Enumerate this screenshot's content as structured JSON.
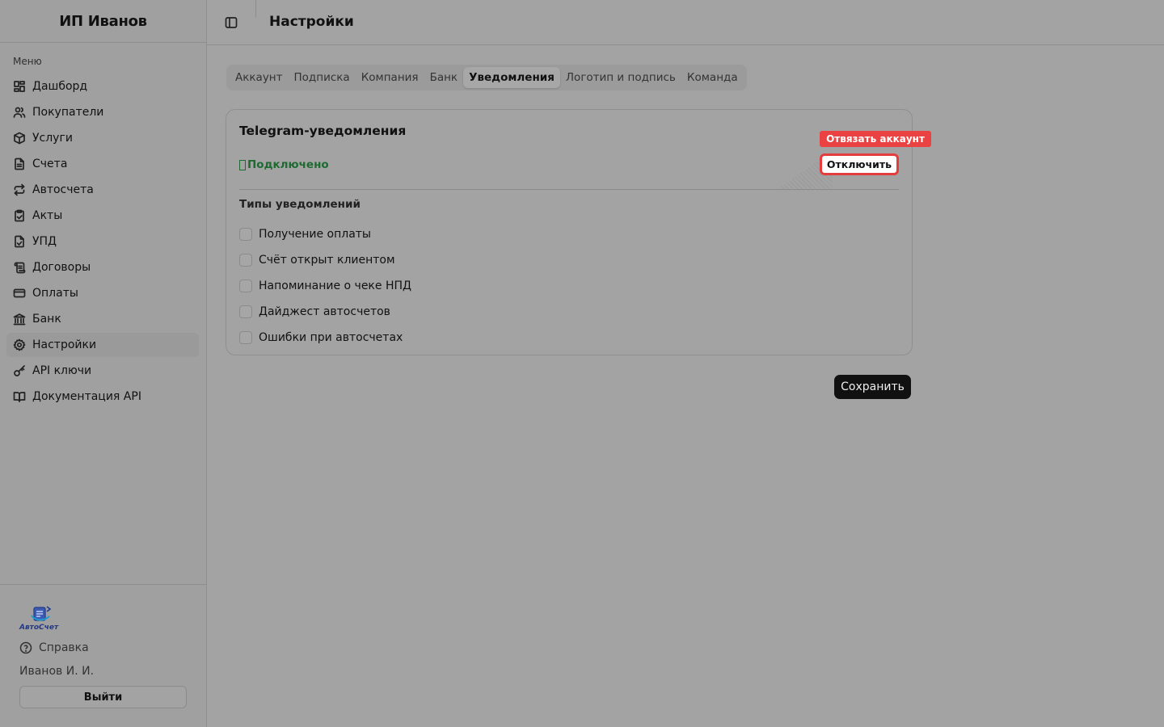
{
  "sidebar": {
    "org_name": "ИП Иванов",
    "menu_label": "Меню",
    "items": [
      {
        "label": "Дашборд",
        "icon": "dashboard-icon"
      },
      {
        "label": "Покупатели",
        "icon": "users-icon"
      },
      {
        "label": "Услуги",
        "icon": "package-icon"
      },
      {
        "label": "Счета",
        "icon": "file-text-icon"
      },
      {
        "label": "Автосчета",
        "icon": "repeat-icon"
      },
      {
        "label": "Акты",
        "icon": "clipboard-check-icon"
      },
      {
        "label": "УПД",
        "icon": "file-check-icon"
      },
      {
        "label": "Договоры",
        "icon": "scroll-icon"
      },
      {
        "label": "Оплаты",
        "icon": "credit-card-icon"
      },
      {
        "label": "Банк",
        "icon": "bank-icon"
      },
      {
        "label": "Настройки",
        "icon": "gear-icon",
        "active": true
      },
      {
        "label": "API ключи",
        "icon": "key-icon"
      },
      {
        "label": "Документация API",
        "icon": "book-icon"
      }
    ],
    "footer": {
      "logo_text": "АвтоСчет",
      "help_label": "Справка",
      "user_name": "Иванов И. И.",
      "logout_label": "Выйти"
    }
  },
  "header": {
    "title": "Настройки"
  },
  "tabs": [
    {
      "label": "Аккаунт"
    },
    {
      "label": "Подписка"
    },
    {
      "label": "Компания"
    },
    {
      "label": "Банк"
    },
    {
      "label": "Уведомления",
      "active": true
    },
    {
      "label": "Логотип и подпись"
    },
    {
      "label": "Команда"
    }
  ],
  "telegram": {
    "title": "Telegram-уведомления",
    "status": "Подключено",
    "disconnect_label": "Отключить",
    "tooltip": "Отвязать аккаунт",
    "types_label": "Типы уведомлений",
    "types": [
      {
        "label": "Получение оплаты",
        "checked": false
      },
      {
        "label": "Счёт открыт клиентом",
        "checked": false
      },
      {
        "label": "Напоминание о чеке НПД",
        "checked": false
      },
      {
        "label": "Дайджест автосчетов",
        "checked": false
      },
      {
        "label": "Ошибки при автосчетах",
        "checked": false
      }
    ]
  },
  "save_label": "Сохранить",
  "colors": {
    "status_green": "#1e6b32",
    "danger_red": "#e53d3d",
    "logo_blue": "#233a86"
  }
}
